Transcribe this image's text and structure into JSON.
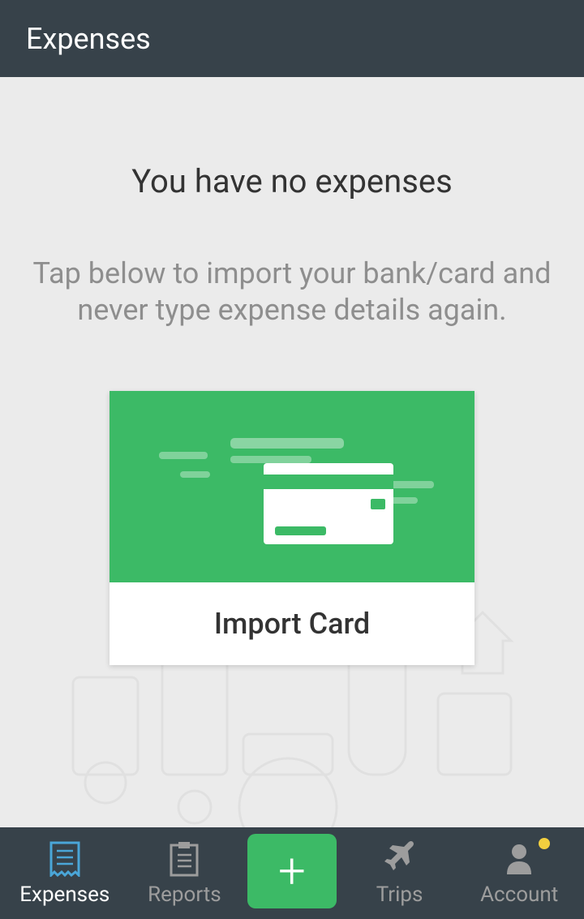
{
  "header": {
    "title": "Expenses"
  },
  "empty": {
    "title": "You have no expenses",
    "sub": "Tap below to import your bank/card and never type expense details again."
  },
  "card": {
    "label": "Import Card"
  },
  "tabs": {
    "expenses": "Expenses",
    "reports": "Reports",
    "trips": "Trips",
    "account": "Account"
  },
  "colors": {
    "accent": "#3cba66",
    "header": "#37424a"
  }
}
